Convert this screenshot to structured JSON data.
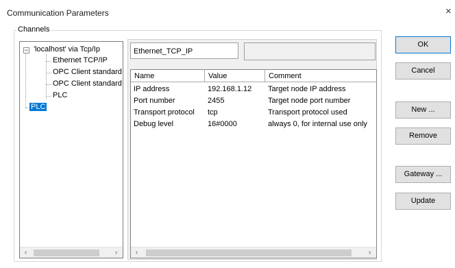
{
  "window": {
    "title": "Communication Parameters",
    "close_glyph": "×"
  },
  "channels": {
    "label": "Channels",
    "tree": [
      {
        "label": "'localhost' via Tcp/Ip",
        "expander": "−"
      },
      {
        "label": "Ethernet TCP/IP"
      },
      {
        "label": "OPC Client standard"
      },
      {
        "label": "OPC Client standard"
      },
      {
        "label": "PLC"
      },
      {
        "label": "PLC",
        "selected": true
      }
    ]
  },
  "driver_tab": {
    "label": "Ethernet_TCP_IP"
  },
  "table": {
    "headers": [
      "Name",
      "Value",
      "Comment"
    ],
    "rows": [
      [
        "IP address",
        "192.168.1.12",
        "Target node IP address"
      ],
      [
        "Port number",
        "2455",
        "Target node port number"
      ],
      [
        "Transport protocol",
        "tcp",
        "Transport protocol used"
      ],
      [
        "Debug level",
        "16#0000",
        "always 0, for internal use only"
      ]
    ]
  },
  "scroll": {
    "left": "‹",
    "right": "›"
  },
  "buttons": {
    "ok": "OK",
    "cancel": "Cancel",
    "new": "New ...",
    "remove": "Remove",
    "gateway": "Gateway ...",
    "update": "Update"
  },
  "colors": {
    "selection": "#0078d7",
    "default_button_border": "#0078d7"
  }
}
